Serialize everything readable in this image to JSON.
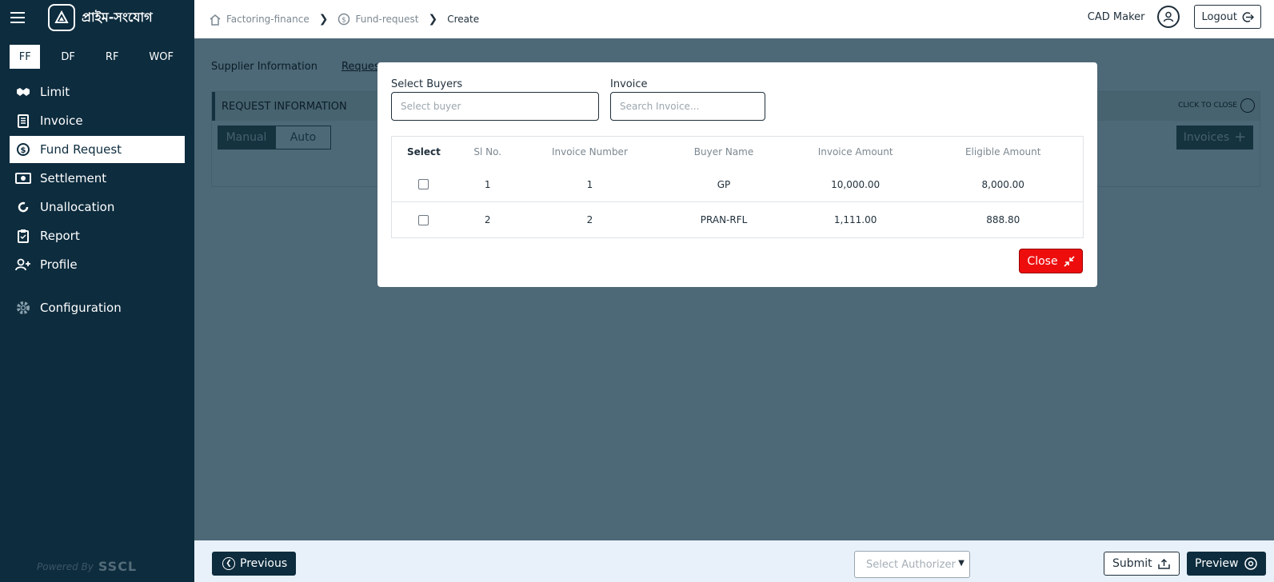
{
  "brand": {
    "name": "প্রাইম-সংযোগ",
    "powered_by": "Powered By",
    "company": "SSCL"
  },
  "product_tabs": [
    "FF",
    "DF",
    "RF",
    "WOF"
  ],
  "nav": [
    {
      "label": "Limit",
      "icon": "handshake-icon"
    },
    {
      "label": "Invoice",
      "icon": "document-icon"
    },
    {
      "label": "Fund Request",
      "icon": "dollar-circle-icon"
    },
    {
      "label": "Settlement",
      "icon": "banknote-icon"
    },
    {
      "label": "Unallocation",
      "icon": "refresh-icon"
    },
    {
      "label": "Report",
      "icon": "clipboard-icon"
    },
    {
      "label": "Profile",
      "icon": "user-plus-icon"
    },
    {
      "label": "Configuration",
      "icon": "gear-icon"
    }
  ],
  "breadcrumb": {
    "home": "Factoring-finance",
    "section": "Fund-request",
    "current": "Create"
  },
  "header": {
    "user": "CAD Maker",
    "logout": "Logout"
  },
  "background": {
    "tab_supplier": "Supplier Information",
    "tab_request": "Reques",
    "panel_title": "REQUEST INFORMATION",
    "click_to_close": "CLICK TO CLOSE",
    "manual": "Manual",
    "auto": "Auto",
    "invoices_button": "Invoices"
  },
  "modal": {
    "buyer_label": "Select Buyers",
    "buyer_placeholder": "Select buyer",
    "invoice_label": "Invoice",
    "invoice_placeholder": "Search Invoice...",
    "columns": [
      "Select",
      "Sl No.",
      "Invoice Number",
      "Buyer Name",
      "Invoice Amount",
      "Eligible Amount"
    ],
    "rows": [
      {
        "sl": "1",
        "invoice_number": "1",
        "buyer": "GP",
        "invoice_amount": "10,000.00",
        "eligible_amount": "8,000.00"
      },
      {
        "sl": "2",
        "invoice_number": "2",
        "buyer": "PRAN-RFL",
        "invoice_amount": "1,111.00",
        "eligible_amount": "888.80"
      }
    ],
    "close": "Close"
  },
  "footer": {
    "previous": "Previous",
    "authorizer_placeholder": "Select Authorizer",
    "submit": "Submit",
    "preview": "Preview"
  },
  "colors": {
    "sidebar": "#0d2c3e",
    "backdrop": "#4d6877",
    "close_button": "#ee0d0d",
    "footer": "#e8f1fa"
  }
}
